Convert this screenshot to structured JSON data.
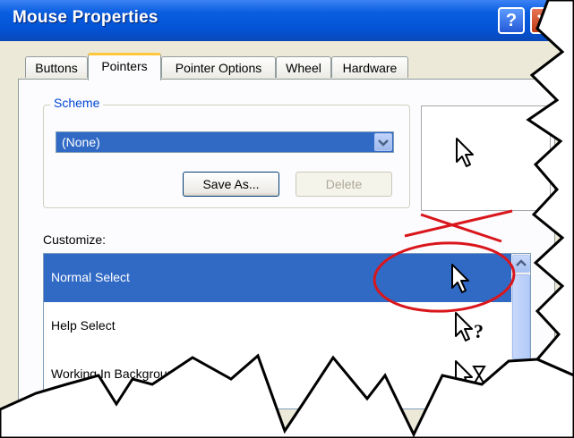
{
  "window": {
    "title": "Mouse Properties"
  },
  "titlebar": {
    "help_label": "?"
  },
  "tabs": [
    {
      "label": "Buttons",
      "active": false
    },
    {
      "label": "Pointers",
      "active": true
    },
    {
      "label": "Pointer Options",
      "active": false
    },
    {
      "label": "Wheel",
      "active": false
    },
    {
      "label": "Hardware",
      "active": false
    }
  ],
  "scheme": {
    "group_label": "Scheme",
    "selected": "(None)",
    "save_as_label": "Save As...",
    "delete_label": "Delete"
  },
  "customize": {
    "label": "Customize:",
    "items": [
      {
        "label": "Normal Select",
        "icon": "arrow-cursor-icon",
        "selected": true
      },
      {
        "label": "Help Select",
        "icon": "help-cursor-icon",
        "selected": false
      },
      {
        "label": "Working In Background",
        "icon": "busy-cursor-icon",
        "selected": false
      }
    ]
  },
  "colors": {
    "titlebar": "#0453d6",
    "selection": "#316ac5",
    "annotation": "#d9161c"
  }
}
